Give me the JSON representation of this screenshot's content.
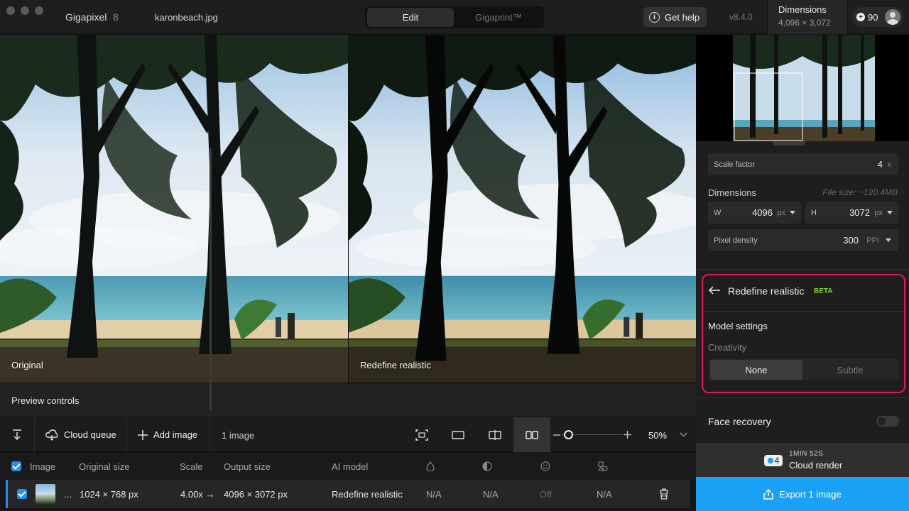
{
  "app": {
    "name": "Gigapixel",
    "version_major": "8",
    "file": "karonbeach.jpg",
    "version": "v8.4.0"
  },
  "modes": {
    "edit": "Edit",
    "gigaprint": "Gigaprint™"
  },
  "header": {
    "help": "Get help",
    "dims_label": "Dimensions",
    "dims_value": "4,096 × 3,072",
    "credits": "90"
  },
  "preview": {
    "left_label": "Original",
    "right_label": "Redefine realistic",
    "controls": "Preview controls"
  },
  "toolbar": {
    "cloud_queue": "Cloud queue",
    "add_image": "Add image",
    "count": "1 image",
    "zoom": "50%"
  },
  "table": {
    "headers": {
      "image": "Image",
      "original": "Original size",
      "scale": "Scale",
      "output": "Output size",
      "model": "AI model"
    },
    "row": {
      "name": "...",
      "original": "1024 × 768 px",
      "scale": "4.00x →",
      "output": "4096 × 3072 px",
      "model": "Redefine realistic",
      "c1": "N/A",
      "c2": "N/A",
      "c3": "Off",
      "c4": "N/A"
    }
  },
  "sidebar": {
    "scale_label": "Scale factor",
    "scale_value": "4",
    "scale_unit": "x",
    "dims_label": "Dimensions",
    "file_size": "File size: ~120.4MB",
    "w_label": "W",
    "w_value": "4096",
    "w_unit": "px",
    "h_label": "H",
    "h_value": "3072",
    "h_unit": "px",
    "density_label": "Pixel density",
    "density_value": "300",
    "density_unit": "PPI",
    "model_title": "Redefine realistic",
    "model_badge": "BETA",
    "model_settings": "Model settings",
    "creativity": "Creativity",
    "creativity_none": "None",
    "creativity_subtle": "Subtle",
    "face_recovery": "Face recovery",
    "render_time": "1MIN 52S",
    "render_label": "Cloud render",
    "render_credits": "4",
    "export": "Export 1 image"
  },
  "colors": {
    "accent_blue": "#1aa0f5",
    "highlight": "#e0195a",
    "beta": "#7ed321"
  }
}
